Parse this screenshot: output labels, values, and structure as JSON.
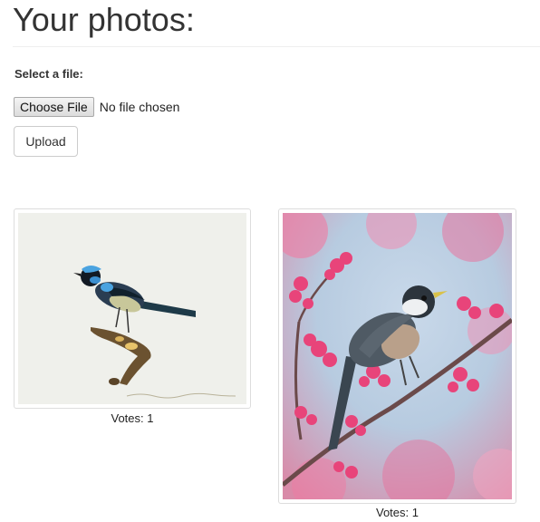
{
  "page": {
    "title": "Your photos:"
  },
  "upload_form": {
    "label": "Select a file:",
    "choose_file_label": "Choose File",
    "file_status": "No file chosen",
    "upload_label": "Upload"
  },
  "photos": [
    {
      "subject": "blue fairy-wren illustration",
      "votes_text": "Votes: 1"
    },
    {
      "subject": "bird on pink blossom branch",
      "votes_text": "Votes: 1"
    }
  ],
  "colors": {
    "text": "#333333",
    "border": "#dddddd",
    "blossom": "#e8447a",
    "sky": "#a9c4dc"
  }
}
